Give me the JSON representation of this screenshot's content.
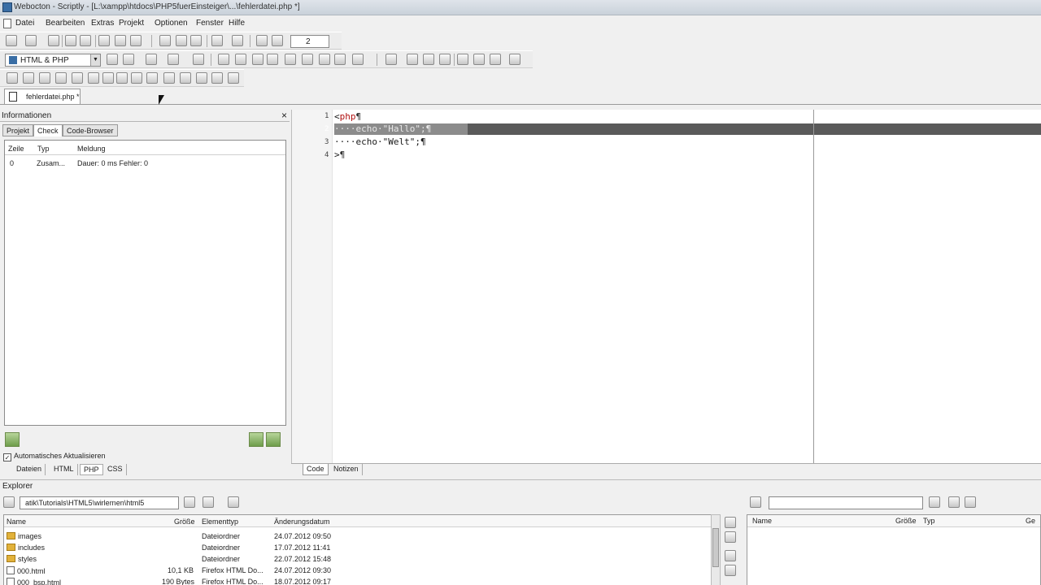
{
  "window": {
    "title": "Webocton - Scriptly - [L:\\xampp\\htdocs\\PHP5fuerEinsteiger\\...\\fehlerdatei.php *]"
  },
  "menu": {
    "items": [
      "Datei",
      "Bearbeiten",
      "Extras",
      "Projekt",
      "Optionen",
      "Fenster",
      "Hilfe"
    ]
  },
  "toolbar": {
    "language_select": "HTML & PHP",
    "counter_value": "2"
  },
  "file_tab": {
    "label": "fehlerdatei.php *"
  },
  "info_panel": {
    "title": "Informationen",
    "close": "×",
    "tabs": [
      "Projekt",
      "Check",
      "Code-Browser"
    ],
    "active_tab": "Check",
    "columns": [
      "Zeile",
      "Typ",
      "Meldung"
    ],
    "rows": [
      {
        "zeile": "0",
        "typ": "Zusam...",
        "meldung": "Dauer: 0 ms  Fehler: 0"
      }
    ],
    "auto_refresh_label": "Automatisches Aktualisieren",
    "auto_refresh_checked": "✓",
    "bottom_tabs": [
      "Dateien",
      "HTML",
      "PHP",
      "CSS"
    ],
    "active_bottom_tab": "PHP"
  },
  "editor": {
    "line_numbers": [
      "1",
      "2",
      "3",
      "4"
    ],
    "lines": {
      "l1_open": "<",
      "l1_kw": "php",
      "l1_end": "¶",
      "l2": "····echo·\"Hallo\";¶",
      "l3": "····echo·\"Welt\";¶",
      "l4_close": ">",
      "l4_end": "¶"
    },
    "bottom_tabs": [
      "Code",
      "Notizen"
    ],
    "active_bottom_tab": "Code"
  },
  "explorer": {
    "title": "Explorer",
    "path": "atik\\Tutorials\\HTML5\\wirlernen\\html5",
    "columns": [
      "Name",
      "Größe",
      "Elementtyp",
      "Änderungsdatum"
    ],
    "files": [
      {
        "name": "images",
        "size": "",
        "type": "Dateiordner",
        "date": "24.07.2012 09:50",
        "kind": "folder"
      },
      {
        "name": "includes",
        "size": "",
        "type": "Dateiordner",
        "date": "17.07.2012 11:41",
        "kind": "folder"
      },
      {
        "name": "styles",
        "size": "",
        "type": "Dateiordner",
        "date": "22.07.2012 15:48",
        "kind": "folder"
      },
      {
        "name": "000.html",
        "size": "10,1 KB",
        "type": "Firefox HTML Do...",
        "date": "24.07.2012 09:30",
        "kind": "file"
      },
      {
        "name": "000_bsp.html",
        "size": "190 Bytes",
        "type": "Firefox HTML Do...",
        "date": "18.07.2012 09:17",
        "kind": "file"
      }
    ],
    "right_columns": [
      "Name",
      "Größe",
      "Typ",
      "Ge"
    ]
  }
}
